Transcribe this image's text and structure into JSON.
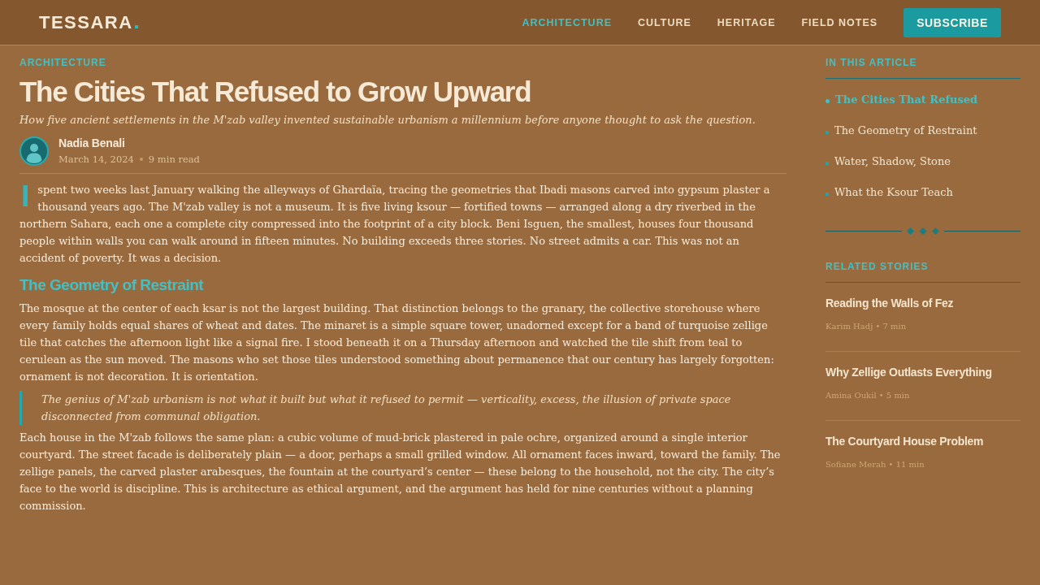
{
  "header": {
    "logo": "TESSARA",
    "nav": [
      {
        "label": "ARCHITECTURE",
        "selected": true
      },
      {
        "label": "CULTURE",
        "selected": false
      },
      {
        "label": "HERITAGE",
        "selected": false
      },
      {
        "label": "FIELD NOTES",
        "selected": false
      }
    ],
    "subscribe_button": "SUBSCRIBE"
  },
  "article": {
    "category": "ARCHITECTURE",
    "title": "The Cities That Refused to Grow Upward",
    "subtitle": "How five ancient settlements in the M'zab valley invented sustainable urbanism a millennium before anyone thought to ask the question.",
    "author": {
      "name": "Nadia Benali",
      "date": "March 14, 2024",
      "read_time": "9 min read"
    },
    "body": [
      {
        "kind": "paragraph",
        "drop_cap": true,
        "text": "I spent two weeks last January walking the alleyways of Ghardaïa, tracing the geometries that Ibadi masons carved into gypsum plaster a thousand years ago. The M'zab valley is not a museum. It is five living ksour — fortified towns — arranged along a dry riverbed in the northern Sahara, each one a complete city compressed into the footprint of a city block. Beni Isguen, the smallest, houses four thousand people within walls you can walk around in fifteen minutes. No building exceeds three stories. No street admits a car. This was not an accident of poverty. It was a decision."
      },
      {
        "kind": "heading",
        "text": "The Geometry of Restraint"
      },
      {
        "kind": "paragraph",
        "drop_cap": false,
        "text": "The mosque at the center of each ksar is not the largest building. That distinction belongs to the granary, the collective storehouse where every family holds equal shares of wheat and dates. The minaret is a simple square tower, unadorned except for a band of turquoise zellige tile that catches the afternoon light like a signal fire. I stood beneath it on a Thursday afternoon and watched the tile shift from teal to cerulean as the sun moved. The masons who set those tiles understood something about permanence that our century has largely forgotten: ornament is not decoration. It is orientation."
      },
      {
        "kind": "quote",
        "text": "The genius of M'zab urbanism is not what it built but what it refused to permit — verticality, excess, the illusion of private space disconnected from communal obligation."
      },
      {
        "kind": "paragraph",
        "drop_cap": false,
        "text": "Each house in the M'zab follows the same plan: a cubic volume of mud-brick plastered in pale ochre, organized around a single interior courtyard. The street facade is deliberately plain — a door, perhaps a small grilled window. All ornament faces inward, toward the family. The zellige panels, the carved plaster arabesques, the fountain at the courtyard’s center — these belong to the household, not the city. The city’s face to the world is discipline. This is architecture as ethical argument, and the argument has held for nine centuries without a planning commission."
      }
    ]
  },
  "sidebar": {
    "toc": {
      "title": "IN THIS ARTICLE",
      "items": [
        {
          "label": "The Cities That Refused",
          "selected": true
        },
        {
          "label": "The Geometry of Restraint",
          "selected": false
        },
        {
          "label": "Water, Shadow, Stone",
          "selected": false
        },
        {
          "label": "What the Ksour Teach",
          "selected": false
        }
      ]
    },
    "related": {
      "title": "RELATED STORIES",
      "items": [
        {
          "title": "Reading the Walls of Fez",
          "meta": "Karim Hadj • 7 min"
        },
        {
          "title": "Why Zellige Outlasts Everything",
          "meta": "Amina Oukil • 5 min"
        },
        {
          "title": "The Courtyard House Problem",
          "meta": "Sofiane Merah • 11 min"
        }
      ]
    }
  }
}
